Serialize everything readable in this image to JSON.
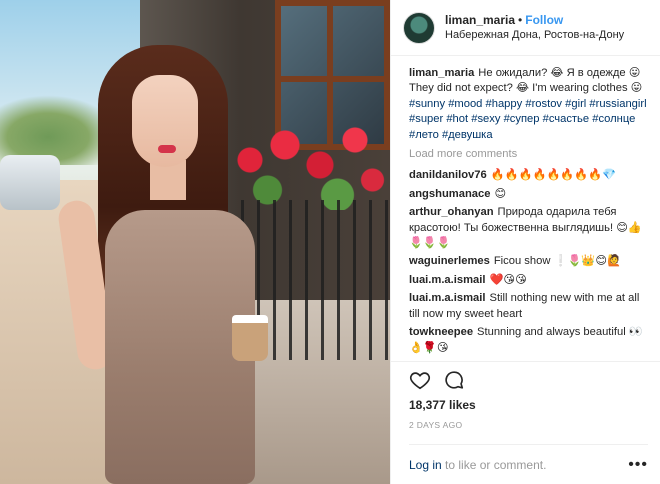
{
  "post": {
    "username": "liman_maria",
    "follow_label": "Follow",
    "separator": "•",
    "location": "Набережная Дона, Ростов-на-Дону"
  },
  "caption": {
    "username": "liman_maria",
    "text_before_tags": "Не ожидали? 😂 Я в одежде 😛 They did not expect? 😂 I'm wearing clothes 😛",
    "hashtags": [
      "#sunny",
      "#mood",
      "#happy",
      "#rostov",
      "#girl",
      "#russiangirl",
      "#super",
      "#hot",
      "#sexy",
      "#супер",
      "#счастье",
      "#солнце",
      "#лето",
      "#девушка"
    ]
  },
  "load_more_label": "Load more comments",
  "comments": [
    {
      "user": "danildanilov76",
      "text": "🔥🔥🔥🔥🔥🔥🔥🔥💎"
    },
    {
      "user": "angshumanace",
      "text": "😊"
    },
    {
      "user": "arthur_ohanyan",
      "text": "Природа одарила тебя красотою! Ты божественна выглядишь! 😊👍🌷🌷🌷"
    },
    {
      "user": "waguinerlemes",
      "text": "Ficou show ❕🌷👑😊🙋"
    },
    {
      "user": "luai.m.a.ismail",
      "text": "❤️😘😘"
    },
    {
      "user": "luai.m.a.ismail",
      "text": "Still nothing new with me at all till now my sweet heart"
    },
    {
      "user": "towkneepee",
      "text": "Stunning and always beautiful 👀👌🌹😘"
    }
  ],
  "actions": {
    "like_icon": "heart-icon",
    "comment_icon": "comment-bubble-icon",
    "likes_text": "18,377 likes",
    "timestamp": "2 DAYS AGO"
  },
  "footer": {
    "login_link": "Log in",
    "login_suffix": "to like or comment.",
    "more_icon": "more-options-icon"
  },
  "colors": {
    "link": "#3897f0",
    "hashtag": "#003569",
    "muted": "#999999"
  }
}
